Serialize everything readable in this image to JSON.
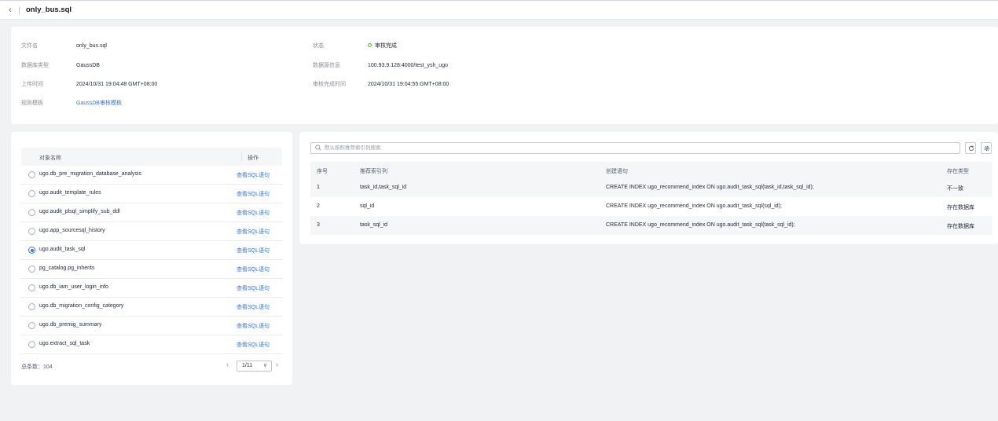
{
  "header": {
    "title": "only_bus.sql"
  },
  "info": {
    "file_name_label": "文件名",
    "file_name": "only_bus.sql",
    "db_type_label": "数据库类型",
    "db_type": "GaussDB",
    "upload_time_label": "上传时间",
    "upload_time": "2024/10/31 19:04:48 GMT+08:00",
    "template_label": "规则模板",
    "template": "GaussDB审核模板",
    "status_label": "状态",
    "status": "审核完成",
    "status_color": "#50b830",
    "datasource_label": "数据源信息",
    "datasource": "100.93.9.128:4000/test_ysh_ugo",
    "complete_time_label": "审核完成时间",
    "complete_time": "2024/10/31 19:04:55 GMT+08:00"
  },
  "objects": {
    "col_name": "对象名称",
    "col_action": "操作",
    "rows": [
      {
        "name": "ugo.db_pre_migration_database_analysis",
        "action": "查看SQL语句",
        "selected": false
      },
      {
        "name": "ugo.audit_template_rules",
        "action": "查看SQL语句",
        "selected": false
      },
      {
        "name": "ugo.audit_plsql_simplify_sub_ddl",
        "action": "查看SQL语句",
        "selected": false
      },
      {
        "name": "ugo.app_sourcesql_history",
        "action": "查看SQL语句",
        "selected": false
      },
      {
        "name": "ugo.audit_task_sql",
        "action": "查看SQL语句",
        "selected": true
      },
      {
        "name": "pg_catalog.pg_inherits",
        "action": "查看SQL语句",
        "selected": false
      },
      {
        "name": "ugo.db_iam_user_login_info",
        "action": "查看SQL语句",
        "selected": false
      },
      {
        "name": "ugo.db_migration_config_category",
        "action": "查看SQL语句",
        "selected": false
      },
      {
        "name": "ugo.db_premig_summary",
        "action": "查看SQL语句",
        "selected": false
      },
      {
        "name": "ugo.extract_sql_task",
        "action": "查看SQL语句",
        "selected": false
      }
    ],
    "total": "总条数：104",
    "page": "1/11"
  },
  "indexes": {
    "search_placeholder": "默认按照推荐索引列搜索",
    "columns": [
      "序号",
      "推荐索引列",
      "创建语句",
      "存在类型"
    ],
    "rows": [
      {
        "no": "1",
        "cols": "task_id,task_sql_id",
        "stmt": "CREATE INDEX ugo_recommend_index ON ugo.audit_task_sql(task_id,task_sql_id);",
        "type": "不一致"
      },
      {
        "no": "2",
        "cols": "sql_id",
        "stmt": "CREATE INDEX ugo_recommend_index ON ugo.audit_task_sql(sql_id);",
        "type": "存在数据库"
      },
      {
        "no": "3",
        "cols": "task_sql_id",
        "stmt": "CREATE INDEX ugo_recommend_index ON ugo.audit_task_sql(task_sql_id);",
        "type": "存在数据库"
      }
    ]
  }
}
